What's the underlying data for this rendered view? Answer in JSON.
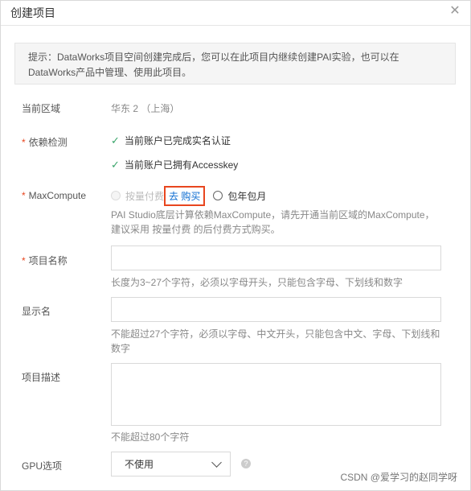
{
  "dialog": {
    "title": "创建项目",
    "close_glyph": "✕"
  },
  "notice": {
    "line1": "提示：DataWorks项目空间创建完成后，您可以在此项目内继续创建PAI实验，也可以在",
    "line2": "DataWorks产品中管理、使用此项目。"
  },
  "fields": {
    "region": {
      "label": "当前区域",
      "value": "华东 2 （上海）"
    },
    "deps": {
      "required_mark": "*",
      "label": "依赖检测",
      "checks": [
        "当前账户已完成实名认证",
        "当前账户已拥有Accesskey"
      ]
    },
    "maxcompute": {
      "required_mark": "*",
      "label": "MaxCompute",
      "option_paygo": "按量付费",
      "buy_link": "去 购买",
      "option_subscription": "包年包月",
      "hint_line1": "PAI Studio底层计算依赖MaxCompute，请先开通当前区域的MaxCompute，",
      "hint_line2": "建议采用 按量付费 的后付费方式购买。"
    },
    "project_name": {
      "required_mark": "*",
      "label": "项目名称",
      "value": "",
      "hint": "长度为3~27个字符，必须以字母开头，只能包含字母、下划线和数字"
    },
    "display_name": {
      "label": "显示名",
      "value": "",
      "hint_line1": "不能超过27个字符，必须以字母、中文开头，只能包含中文、字母、下划线和",
      "hint_line2": "数字"
    },
    "description": {
      "label": "项目描述",
      "value": "",
      "hint": "不能超过80个字符"
    },
    "gpu": {
      "label": "GPU选项",
      "selected": "不使用",
      "help_glyph": "?"
    }
  },
  "watermark": "CSDN @爱学习的赵同学呀"
}
